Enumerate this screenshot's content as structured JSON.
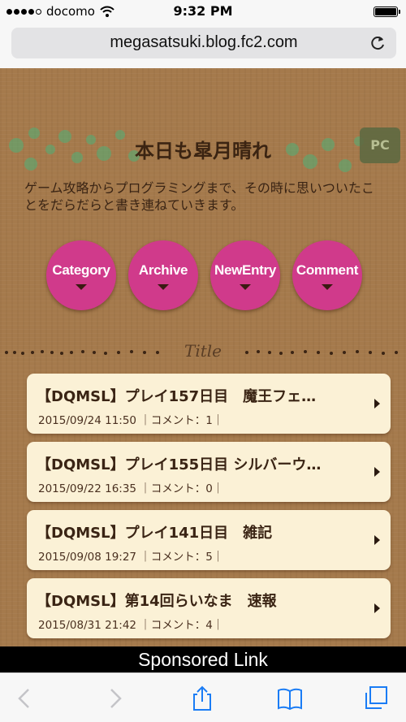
{
  "status_bar": {
    "carrier": "docomo",
    "time": "9:32 PM",
    "signal_icon": "signal-bars-icon",
    "wifi_icon": "wifi-icon",
    "battery_icon": "battery-icon"
  },
  "browser": {
    "url": "megasatsuki.blog.fc2.com",
    "reload_icon": "reload-icon"
  },
  "site": {
    "title": "本日も皐月晴れ",
    "pc_button": "PC",
    "description": "ゲーム攻略からプログラミングまで、その時に思いついたことをだらだらと書き連ねていきます。"
  },
  "nav": [
    {
      "label": "Category"
    },
    {
      "label": "Archive"
    },
    {
      "label": "NewEntry"
    },
    {
      "label": "Comment"
    }
  ],
  "colors": {
    "nav_button": "#d03a8b",
    "background": "#a57a4c",
    "card": "#fbf1d6"
  },
  "section_title": "Title",
  "entries": [
    {
      "title": "【DQMSL】プレイ157日目　魔王フェ…",
      "meta": "2015/09/24 11:50 ｜コメント：1｜"
    },
    {
      "title": "【DQMSL】プレイ155日目 シルバーウ…",
      "meta": "2015/09/22 16:35 ｜コメント：0｜"
    },
    {
      "title": "【DQMSL】プレイ141日目　雑記",
      "meta": "2015/09/08 19:27 ｜コメント：5｜"
    },
    {
      "title": "【DQMSL】第14回らいなま　速報",
      "meta": "2015/08/31 21:42 ｜コメント：4｜"
    }
  ],
  "sponsored": "Sponsored Link",
  "toolbar": {
    "back_icon": "back-arrow-icon",
    "forward_icon": "forward-arrow-icon",
    "share_icon": "share-icon",
    "bookmarks_icon": "bookmarks-icon",
    "tabs_icon": "tabs-icon"
  }
}
